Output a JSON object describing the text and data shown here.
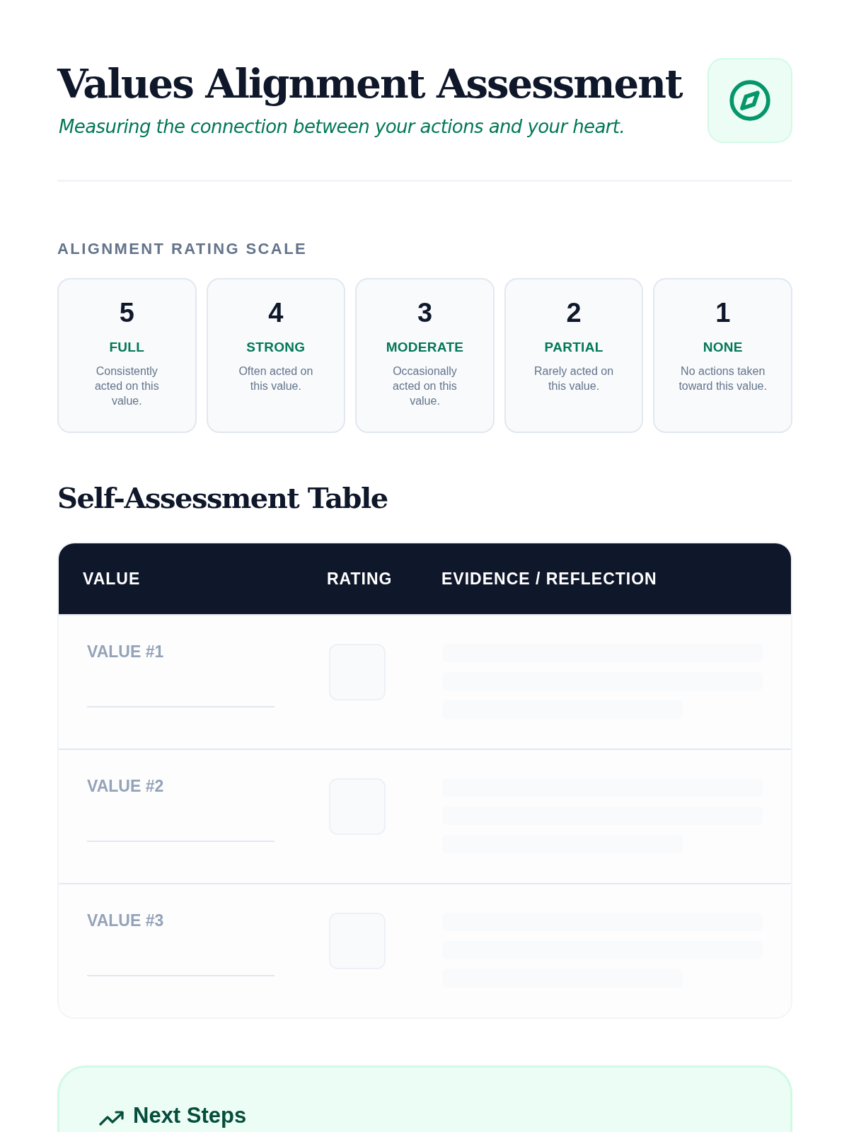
{
  "header": {
    "title": "Values Alignment Assessment",
    "subtitle": "Measuring the connection between your actions and your heart."
  },
  "scale": {
    "heading": "ALIGNMENT RATING SCALE",
    "levels": [
      {
        "number": "5",
        "label": "FULL",
        "description": "Consistently acted on this value."
      },
      {
        "number": "4",
        "label": "STRONG",
        "description": "Often acted on this value."
      },
      {
        "number": "3",
        "label": "MODERATE",
        "description": "Occasionally acted on this value."
      },
      {
        "number": "2",
        "label": "PARTIAL",
        "description": "Rarely acted on this value."
      },
      {
        "number": "1",
        "label": "NONE",
        "description": "No actions taken toward this value."
      }
    ]
  },
  "table": {
    "heading": "Self-Assessment Table",
    "columns": [
      "VALUE",
      "RATING",
      "EVIDENCE / REFLECTION"
    ],
    "rows": [
      {
        "value": "VALUE #1"
      },
      {
        "value": "VALUE #2"
      },
      {
        "value": "VALUE #3"
      }
    ]
  },
  "next_steps": {
    "title": "Next Steps"
  }
}
